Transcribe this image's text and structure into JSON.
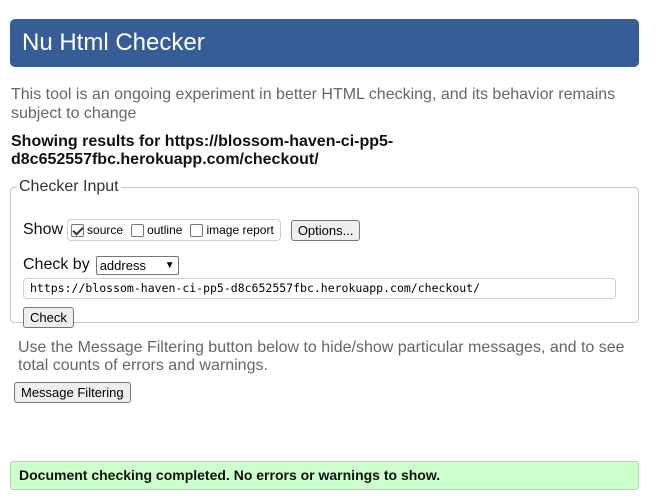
{
  "header": {
    "title": "Nu Html Checker"
  },
  "intro": {
    "text": "This tool is an ongoing experiment in better HTML checking, and its behavior remains subject to change"
  },
  "showing": {
    "line1": "Showing results for https://blossom-haven-ci-pp5-",
    "line2": "d8c652557fbc.herokuapp.com/checkout/"
  },
  "checker": {
    "legend": "Checker Input",
    "show_label": "Show",
    "options": [
      {
        "label": "source",
        "checked": true
      },
      {
        "label": "outline",
        "checked": false
      },
      {
        "label": "image report",
        "checked": false
      }
    ],
    "options_button": "Options...",
    "check_by_label": "Check by",
    "check_by_value": "address",
    "url_value": "https://blossom-haven-ci-pp5-d8c652557fbc.herokuapp.com/checkout/",
    "check_button": "Check"
  },
  "filtering": {
    "text": "Use the Message Filtering button below to hide/show particular messages, and to see total counts of errors and warnings.",
    "button": "Message Filtering"
  },
  "result": {
    "message": "Document checking completed. No errors or warnings to show."
  }
}
